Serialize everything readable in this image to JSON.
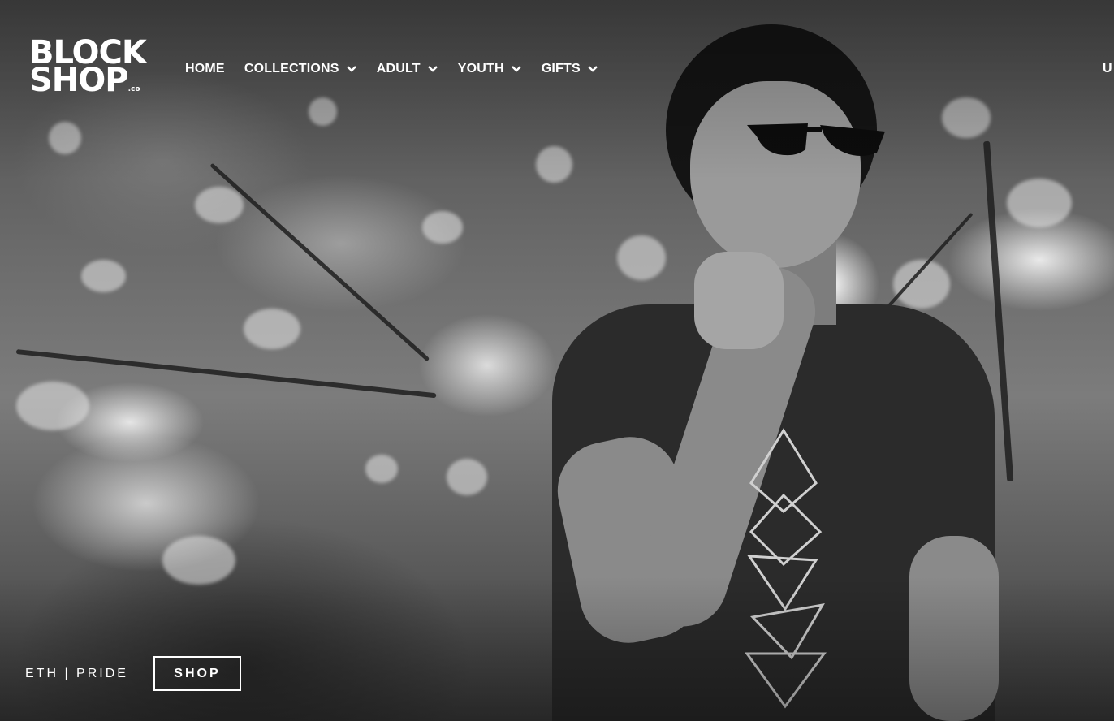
{
  "brand": {
    "logo_line1": "BLOCK",
    "logo_line2": "SHOP",
    "logo_suffix": ".co"
  },
  "nav": {
    "items": [
      {
        "label": "HOME",
        "has_dropdown": false
      },
      {
        "label": "COLLECTIONS",
        "has_dropdown": true
      },
      {
        "label": "ADULT",
        "has_dropdown": true
      },
      {
        "label": "YOUTH",
        "has_dropdown": true
      },
      {
        "label": "GIFTS",
        "has_dropdown": true
      }
    ],
    "utility_partial": "U"
  },
  "hero": {
    "caption": "ETH | PRIDE",
    "cta_label": "SHOP",
    "image": "man-in-sunglasses-tshirt-bw-photo"
  },
  "colors": {
    "text": "#ffffff",
    "overlay": "#000000"
  }
}
